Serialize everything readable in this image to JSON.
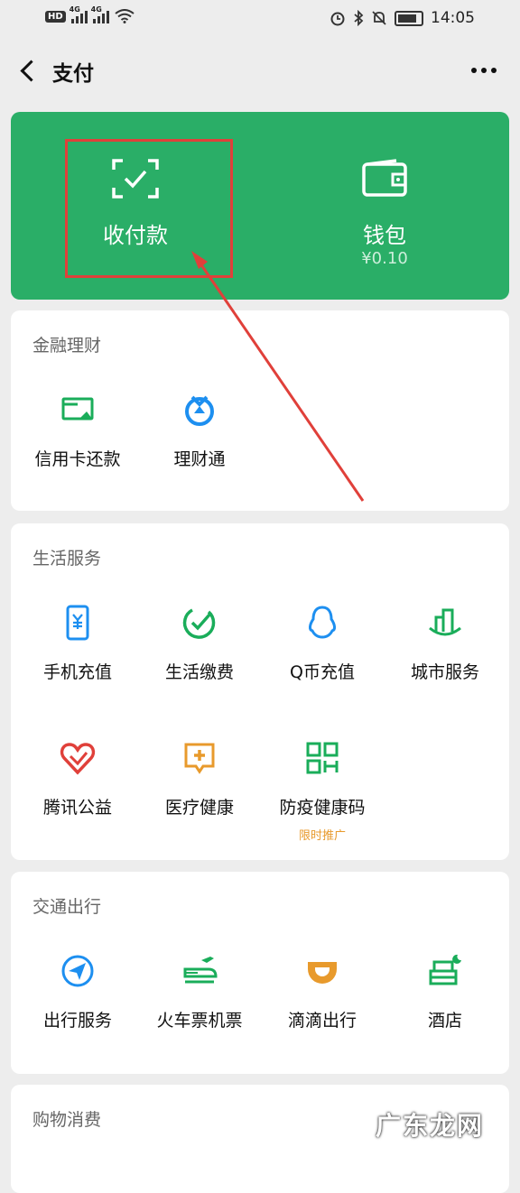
{
  "status_bar": {
    "hd": "HD",
    "net1": "4G",
    "net2": "4G",
    "time": "14:05"
  },
  "nav": {
    "title": "支付"
  },
  "top_card": {
    "pay_label": "收付款",
    "wallet_label": "钱包",
    "wallet_balance": "¥0.10"
  },
  "finance": {
    "title": "金融理财",
    "items": [
      {
        "label": "信用卡还款",
        "icon": "credit-card-icon"
      },
      {
        "label": "理财通",
        "icon": "wealth-icon"
      }
    ]
  },
  "life": {
    "title": "生活服务",
    "items": [
      {
        "label": "手机充值",
        "icon": "phone-recharge-icon"
      },
      {
        "label": "生活缴费",
        "icon": "utility-payment-icon"
      },
      {
        "label": "Q币充值",
        "icon": "qq-coin-icon"
      },
      {
        "label": "城市服务",
        "icon": "city-service-icon"
      },
      {
        "label": "腾讯公益",
        "icon": "charity-heart-icon"
      },
      {
        "label": "医疗健康",
        "icon": "medical-icon"
      },
      {
        "label": "防疫健康码",
        "icon": "qr-code-icon",
        "badge": "限时推广"
      }
    ]
  },
  "transport": {
    "title": "交通出行",
    "items": [
      {
        "label": "出行服务",
        "icon": "navigation-icon"
      },
      {
        "label": "火车票机票",
        "icon": "train-plane-icon"
      },
      {
        "label": "滴滴出行",
        "icon": "didi-icon"
      },
      {
        "label": "酒店",
        "icon": "hotel-bed-icon"
      }
    ]
  },
  "shopping": {
    "title": "购物消费"
  },
  "watermark": "广东龙网",
  "colors": {
    "primary_green": "#2aae67",
    "icon_blue": "#1d8ff0",
    "icon_green": "#1aad5a",
    "icon_red": "#e0403a",
    "icon_orange": "#e89a2c",
    "annotation_red": "#e0403a"
  }
}
